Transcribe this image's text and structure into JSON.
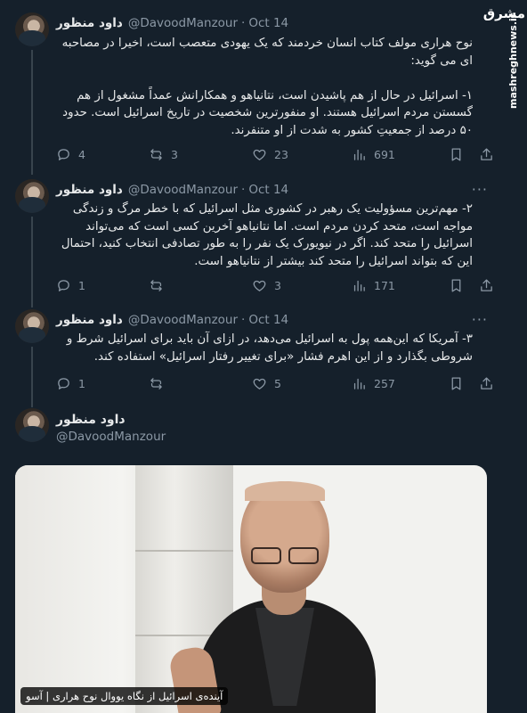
{
  "tweets": [
    {
      "author": "داود منظور",
      "handle": "@DavoodManzour",
      "dot": "·",
      "date": "Oct 14",
      "text": "نوح هراری مولف کتاب انسان خردمند که یک یهودی متعصب است، اخیرا در مصاحبه ای می گوید:\n\n۱- اسرائیل در حال از هم پاشیدن است، نتانیاهو و همکارانش عمداً مشغول از هم گسستن مردم اسرائیل هستند. او منفورترین شخصیت در تاریخ اسرائیل است. حدود ۵۰ درصد از جمعیتِ کشور به شدت از او متنفرند.",
      "replies": "4",
      "retweets": "3",
      "likes": "23",
      "views": "691"
    },
    {
      "author": "داود منظور",
      "handle": "@DavoodManzour",
      "dot": "·",
      "date": "Oct 14",
      "text": "۲- مهم‌ترین مسؤولیت یک رهبر در کشوری مثل اسرائیل که با خطر مرگ و زندگی مواجه است، متحد کردن مردم است. اما نتانیاهو آخرین کسی است که می‌تواند اسرائیل را متحد کند. اگر در نیویورک یک نفر را به طور تصادفی انتخاب کنید، احتمال این که بتواند اسرائیل را متحد کند بیشتر از نتانیاهو است.",
      "replies": "1",
      "retweets": "",
      "likes": "3",
      "views": "171"
    },
    {
      "author": "داود منظور",
      "handle": "@DavoodManzour",
      "dot": "·",
      "date": "Oct 14",
      "text": "۳- آمریکا که این‌همه پول به اسرائیل می‌دهد، در ازای آن باید برای اسرائیل شرط و شروطی بگذارد و از این اهرم فشار «برای تغییر رفتار اسرائیل» استفاده کند.",
      "replies": "1",
      "retweets": "",
      "likes": "5",
      "views": "257"
    }
  ],
  "profile": {
    "name": "داود منظور",
    "handle": "@DavoodManzour"
  },
  "photo": {
    "caption": "آینده‌ی اسرائیل از نگاه یووال نوح هراری | آسو"
  },
  "watermark": {
    "site": "mashreghnews.ir",
    "logo": "مشرق"
  },
  "icons": [
    "reply-icon",
    "retweet-icon",
    "like-icon",
    "views-icon",
    "bookmark-icon",
    "share-icon",
    "more-icon"
  ],
  "colors": {
    "background": "#15202b",
    "text": "#e7e9ea",
    "muted": "#8b98a5",
    "thread_line": "#38444d"
  }
}
